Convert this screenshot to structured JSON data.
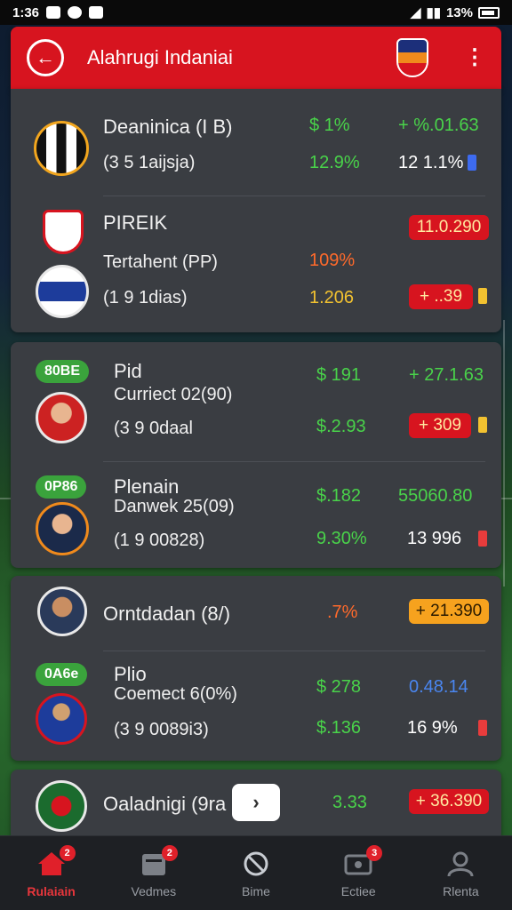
{
  "status_bar": {
    "time": "1:36",
    "battery": "13%"
  },
  "header": {
    "title": "Alahrugi Indaniai"
  },
  "cards": [
    {
      "rows": [
        {
          "name": "Deaninica (I B)",
          "sub": "(3 5 1aijsja)",
          "v1": "$ 1%",
          "v2": "12.9%",
          "v3": "+ %.01.63",
          "v4": "12  1.1%"
        },
        {
          "name": "PIREIK",
          "sub": "Tertahent (PP)",
          "sub2": "(1 9 1dias)",
          "v1": "109%",
          "v2": "1.206",
          "v3": "11.0.290",
          "v4": "+ ..39"
        }
      ]
    },
    {
      "rows": [
        {
          "badge": "80BE",
          "name": "Pid",
          "sub": "Curriect 02(90)",
          "sub2": "(3 9 0daal",
          "v1": "$ 191",
          "v2": "$.2.93",
          "v3": "+ 27.1.63",
          "v4": "+ 309"
        },
        {
          "badge": "0P86",
          "name": "Plenain",
          "sub": "Danwek 25(09)",
          "sub2": "(1 9 00828)",
          "v1": "$.182",
          "v2": "9.30%",
          "v3": "55060.80",
          "v4": "13  996"
        }
      ]
    },
    {
      "rows": [
        {
          "name": "Orntdadan (8/)",
          "v1": ".7%",
          "v3": "+ 21.390"
        },
        {
          "badge": "0A6e",
          "name": "Plio",
          "sub": "Coemect 6(0%)",
          "sub2": "(3 9 0089i3)",
          "v1": "$ 278",
          "v2": "$.136",
          "v3": "0.48.14",
          "v4": "16  9%"
        }
      ]
    },
    {
      "rows": [
        {
          "name": "Oaladnigi (9ra",
          "v1": "3.33",
          "v3": "+ 36.390"
        }
      ]
    }
  ],
  "bottom_nav": [
    {
      "label": "Rulaiain",
      "badge": "2",
      "icon": "home-icon",
      "active": true
    },
    {
      "label": "Vedmes",
      "badge": "2",
      "icon": "calendar-icon",
      "active": false
    },
    {
      "label": "Bime",
      "badge": "",
      "icon": "ball-icon",
      "active": false
    },
    {
      "label": "Ectiee",
      "badge": "3",
      "icon": "ticket-icon",
      "active": false
    },
    {
      "label": "Rlenta",
      "badge": "",
      "icon": "profile-icon",
      "active": false
    }
  ]
}
